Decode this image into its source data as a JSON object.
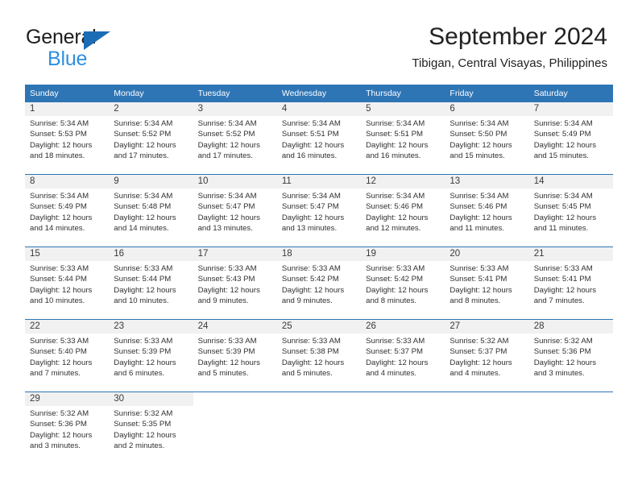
{
  "brand": {
    "word_one": "General",
    "word_two": "Blue",
    "triangle_color": "#1c6cb5",
    "blue_text_color": "#2e8fe0"
  },
  "header": {
    "month_title": "September 2024",
    "location": "Tibigan, Central Visayas, Philippines"
  },
  "theme": {
    "header_bar_color": "#2e75b6",
    "daynum_strip_color": "#f1f1f1",
    "row_divider_color": "#2e75b6",
    "text_color": "#303030"
  },
  "calendar": {
    "weekday_headers": [
      "Sunday",
      "Monday",
      "Tuesday",
      "Wednesday",
      "Thursday",
      "Friday",
      "Saturday"
    ],
    "weeks": [
      [
        {
          "day": "1",
          "sunrise": "Sunrise: 5:34 AM",
          "sunset": "Sunset: 5:53 PM",
          "daylight_line1": "Daylight: 12 hours",
          "daylight_line2": "and 18 minutes."
        },
        {
          "day": "2",
          "sunrise": "Sunrise: 5:34 AM",
          "sunset": "Sunset: 5:52 PM",
          "daylight_line1": "Daylight: 12 hours",
          "daylight_line2": "and 17 minutes."
        },
        {
          "day": "3",
          "sunrise": "Sunrise: 5:34 AM",
          "sunset": "Sunset: 5:52 PM",
          "daylight_line1": "Daylight: 12 hours",
          "daylight_line2": "and 17 minutes."
        },
        {
          "day": "4",
          "sunrise": "Sunrise: 5:34 AM",
          "sunset": "Sunset: 5:51 PM",
          "daylight_line1": "Daylight: 12 hours",
          "daylight_line2": "and 16 minutes."
        },
        {
          "day": "5",
          "sunrise": "Sunrise: 5:34 AM",
          "sunset": "Sunset: 5:51 PM",
          "daylight_line1": "Daylight: 12 hours",
          "daylight_line2": "and 16 minutes."
        },
        {
          "day": "6",
          "sunrise": "Sunrise: 5:34 AM",
          "sunset": "Sunset: 5:50 PM",
          "daylight_line1": "Daylight: 12 hours",
          "daylight_line2": "and 15 minutes."
        },
        {
          "day": "7",
          "sunrise": "Sunrise: 5:34 AM",
          "sunset": "Sunset: 5:49 PM",
          "daylight_line1": "Daylight: 12 hours",
          "daylight_line2": "and 15 minutes."
        }
      ],
      [
        {
          "day": "8",
          "sunrise": "Sunrise: 5:34 AM",
          "sunset": "Sunset: 5:49 PM",
          "daylight_line1": "Daylight: 12 hours",
          "daylight_line2": "and 14 minutes."
        },
        {
          "day": "9",
          "sunrise": "Sunrise: 5:34 AM",
          "sunset": "Sunset: 5:48 PM",
          "daylight_line1": "Daylight: 12 hours",
          "daylight_line2": "and 14 minutes."
        },
        {
          "day": "10",
          "sunrise": "Sunrise: 5:34 AM",
          "sunset": "Sunset: 5:47 PM",
          "daylight_line1": "Daylight: 12 hours",
          "daylight_line2": "and 13 minutes."
        },
        {
          "day": "11",
          "sunrise": "Sunrise: 5:34 AM",
          "sunset": "Sunset: 5:47 PM",
          "daylight_line1": "Daylight: 12 hours",
          "daylight_line2": "and 13 minutes."
        },
        {
          "day": "12",
          "sunrise": "Sunrise: 5:34 AM",
          "sunset": "Sunset: 5:46 PM",
          "daylight_line1": "Daylight: 12 hours",
          "daylight_line2": "and 12 minutes."
        },
        {
          "day": "13",
          "sunrise": "Sunrise: 5:34 AM",
          "sunset": "Sunset: 5:46 PM",
          "daylight_line1": "Daylight: 12 hours",
          "daylight_line2": "and 11 minutes."
        },
        {
          "day": "14",
          "sunrise": "Sunrise: 5:34 AM",
          "sunset": "Sunset: 5:45 PM",
          "daylight_line1": "Daylight: 12 hours",
          "daylight_line2": "and 11 minutes."
        }
      ],
      [
        {
          "day": "15",
          "sunrise": "Sunrise: 5:33 AM",
          "sunset": "Sunset: 5:44 PM",
          "daylight_line1": "Daylight: 12 hours",
          "daylight_line2": "and 10 minutes."
        },
        {
          "day": "16",
          "sunrise": "Sunrise: 5:33 AM",
          "sunset": "Sunset: 5:44 PM",
          "daylight_line1": "Daylight: 12 hours",
          "daylight_line2": "and 10 minutes."
        },
        {
          "day": "17",
          "sunrise": "Sunrise: 5:33 AM",
          "sunset": "Sunset: 5:43 PM",
          "daylight_line1": "Daylight: 12 hours",
          "daylight_line2": "and 9 minutes."
        },
        {
          "day": "18",
          "sunrise": "Sunrise: 5:33 AM",
          "sunset": "Sunset: 5:42 PM",
          "daylight_line1": "Daylight: 12 hours",
          "daylight_line2": "and 9 minutes."
        },
        {
          "day": "19",
          "sunrise": "Sunrise: 5:33 AM",
          "sunset": "Sunset: 5:42 PM",
          "daylight_line1": "Daylight: 12 hours",
          "daylight_line2": "and 8 minutes."
        },
        {
          "day": "20",
          "sunrise": "Sunrise: 5:33 AM",
          "sunset": "Sunset: 5:41 PM",
          "daylight_line1": "Daylight: 12 hours",
          "daylight_line2": "and 8 minutes."
        },
        {
          "day": "21",
          "sunrise": "Sunrise: 5:33 AM",
          "sunset": "Sunset: 5:41 PM",
          "daylight_line1": "Daylight: 12 hours",
          "daylight_line2": "and 7 minutes."
        }
      ],
      [
        {
          "day": "22",
          "sunrise": "Sunrise: 5:33 AM",
          "sunset": "Sunset: 5:40 PM",
          "daylight_line1": "Daylight: 12 hours",
          "daylight_line2": "and 7 minutes."
        },
        {
          "day": "23",
          "sunrise": "Sunrise: 5:33 AM",
          "sunset": "Sunset: 5:39 PM",
          "daylight_line1": "Daylight: 12 hours",
          "daylight_line2": "and 6 minutes."
        },
        {
          "day": "24",
          "sunrise": "Sunrise: 5:33 AM",
          "sunset": "Sunset: 5:39 PM",
          "daylight_line1": "Daylight: 12 hours",
          "daylight_line2": "and 5 minutes."
        },
        {
          "day": "25",
          "sunrise": "Sunrise: 5:33 AM",
          "sunset": "Sunset: 5:38 PM",
          "daylight_line1": "Daylight: 12 hours",
          "daylight_line2": "and 5 minutes."
        },
        {
          "day": "26",
          "sunrise": "Sunrise: 5:33 AM",
          "sunset": "Sunset: 5:37 PM",
          "daylight_line1": "Daylight: 12 hours",
          "daylight_line2": "and 4 minutes."
        },
        {
          "day": "27",
          "sunrise": "Sunrise: 5:32 AM",
          "sunset": "Sunset: 5:37 PM",
          "daylight_line1": "Daylight: 12 hours",
          "daylight_line2": "and 4 minutes."
        },
        {
          "day": "28",
          "sunrise": "Sunrise: 5:32 AM",
          "sunset": "Sunset: 5:36 PM",
          "daylight_line1": "Daylight: 12 hours",
          "daylight_line2": "and 3 minutes."
        }
      ],
      [
        {
          "day": "29",
          "sunrise": "Sunrise: 5:32 AM",
          "sunset": "Sunset: 5:36 PM",
          "daylight_line1": "Daylight: 12 hours",
          "daylight_line2": "and 3 minutes."
        },
        {
          "day": "30",
          "sunrise": "Sunrise: 5:32 AM",
          "sunset": "Sunset: 5:35 PM",
          "daylight_line1": "Daylight: 12 hours",
          "daylight_line2": "and 2 minutes."
        },
        {
          "day": "",
          "sunrise": "",
          "sunset": "",
          "daylight_line1": "",
          "daylight_line2": ""
        },
        {
          "day": "",
          "sunrise": "",
          "sunset": "",
          "daylight_line1": "",
          "daylight_line2": ""
        },
        {
          "day": "",
          "sunrise": "",
          "sunset": "",
          "daylight_line1": "",
          "daylight_line2": ""
        },
        {
          "day": "",
          "sunrise": "",
          "sunset": "",
          "daylight_line1": "",
          "daylight_line2": ""
        },
        {
          "day": "",
          "sunrise": "",
          "sunset": "",
          "daylight_line1": "",
          "daylight_line2": ""
        }
      ]
    ]
  }
}
